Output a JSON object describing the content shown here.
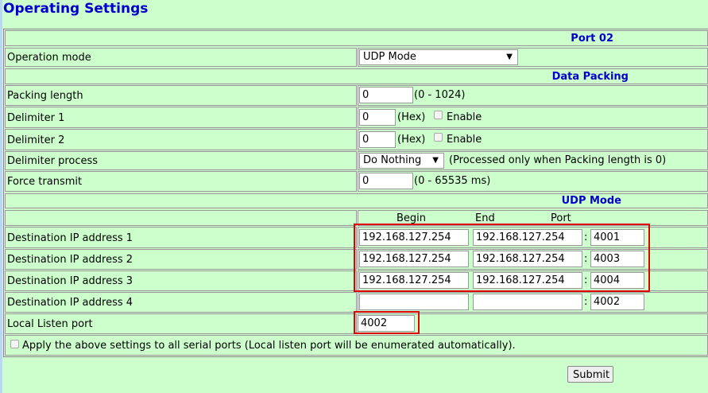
{
  "title": "Operating Settings",
  "port_header": "Port 02",
  "operation_mode": {
    "label": "Operation mode",
    "value": "UDP Mode"
  },
  "data_packing": {
    "header": "Data Packing",
    "packing_length": {
      "label": "Packing length",
      "value": "0",
      "hint": "(0 - 1024)"
    },
    "delimiter1": {
      "label": "Delimiter 1",
      "value": "0",
      "hex": "(Hex)",
      "enable": "Enable"
    },
    "delimiter2": {
      "label": "Delimiter 2",
      "value": "0",
      "hex": "(Hex)",
      "enable": "Enable"
    },
    "delimiter_process": {
      "label": "Delimiter process",
      "value": "Do Nothing",
      "hint": "(Processed only when Packing length is 0)"
    },
    "force_transmit": {
      "label": "Force transmit",
      "value": "0",
      "hint": "(0 - 65535 ms)"
    }
  },
  "udp": {
    "header": "UDP Mode",
    "col_begin": "Begin",
    "col_end": "End",
    "col_port": "Port",
    "sep": ":",
    "dest1": {
      "label": "Destination IP address 1",
      "begin": "192.168.127.254",
      "end": "192.168.127.254",
      "port": "4001"
    },
    "dest2": {
      "label": "Destination IP address 2",
      "begin": "192.168.127.254",
      "end": "192.168.127.254",
      "port": "4003"
    },
    "dest3": {
      "label": "Destination IP address 3",
      "begin": "192.168.127.254",
      "end": "192.168.127.254",
      "port": "4004"
    },
    "dest4": {
      "label": "Destination IP address 4",
      "begin": "",
      "end": "",
      "port": "4002"
    },
    "local_listen": {
      "label": "Local Listen port",
      "value": "4002"
    }
  },
  "apply_all": "Apply the above settings to all serial ports (Local listen port will be enumerated automatically).",
  "submit": "Submit"
}
